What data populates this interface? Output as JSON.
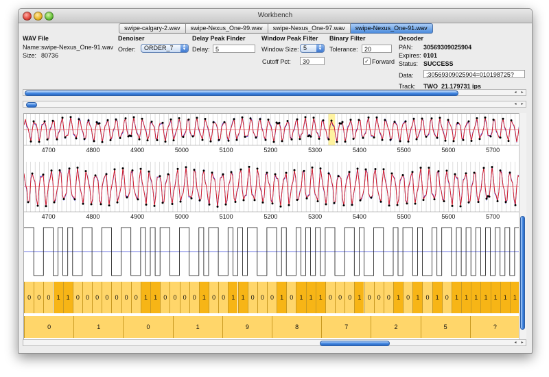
{
  "window": {
    "title": "Workbench"
  },
  "tabs": [
    {
      "label": "swipe-calgary-2.wav",
      "active": false
    },
    {
      "label": "swipe-Nexus_One-99.wav",
      "active": false
    },
    {
      "label": "swipe-Nexus_One-97.wav",
      "active": false
    },
    {
      "label": "swipe-Nexus_One-91.wav",
      "active": true
    }
  ],
  "wav_file": {
    "title": "WAV File",
    "name_label": "Name:",
    "name": "swipe-Nexus_One-91.wav",
    "size_label": "Size:",
    "size": "80736"
  },
  "denoiser": {
    "title": "Denoiser",
    "order_label": "Order:",
    "order": "ORDER_7"
  },
  "delay_peak": {
    "title": "Delay Peak Finder",
    "delay_label": "Delay:",
    "delay": "5"
  },
  "window_peak": {
    "title": "Window Peak Filter",
    "size_label": "Window Size:",
    "size": "5",
    "cutoff_label": "Cutoff Pct:",
    "cutoff": "30"
  },
  "binary_filter": {
    "title": "Binary Filter",
    "tolerance_label": "Tolerance:",
    "tolerance": "20",
    "forward_label": "Forward",
    "forward_checked": true
  },
  "decoder": {
    "title": "Decoder",
    "pan_label": "PAN:",
    "pan": "30569309025904",
    "expires_label": "Expires:",
    "expires": "0101",
    "status_label": "Status:",
    "status": "SUCCESS",
    "data_label": "Data:",
    "data": ";30569309025904=010198725?",
    "track_label": "Track:",
    "track": "TWO",
    "rate": "21.179731 ips"
  },
  "scroll_glyphs": {
    "left": "◂",
    "right": "▸"
  },
  "waveform_axis": {
    "ticks": [
      "4700",
      "4800",
      "4900",
      "5000",
      "5100",
      "5200",
      "5300",
      "5400",
      "5500",
      "5600",
      "5700"
    ],
    "highlight_range": [
      5330,
      5345
    ]
  },
  "bits": [
    "0",
    "0",
    "0",
    "1",
    "1",
    "0",
    "0",
    "0",
    "0",
    "0",
    "0",
    "0",
    "1",
    "1",
    "0",
    "0",
    "0",
    "0",
    "1",
    "0",
    "0",
    "1",
    "1",
    "0",
    "0",
    "0",
    "1",
    "0",
    "1",
    "1",
    "1",
    "0",
    "0",
    "0",
    "1",
    "0",
    "0",
    "0",
    "1",
    "0",
    "1",
    "0",
    "1",
    "0",
    "1",
    "1",
    "1",
    "1",
    "1",
    "1",
    "1"
  ],
  "decoded_chars": [
    "0",
    "1",
    "0",
    "1",
    "9",
    "8",
    "7",
    "2",
    "5",
    "?"
  ],
  "colors": {
    "bit_zero": "#ffd66a",
    "bit_one": "#f7b516",
    "char_cell": "#ffd66a",
    "signal_red": "#e02020",
    "signal_blue": "#2c2cd8",
    "baseline_blue": "#3a48d8",
    "accent": "#3f84df"
  }
}
